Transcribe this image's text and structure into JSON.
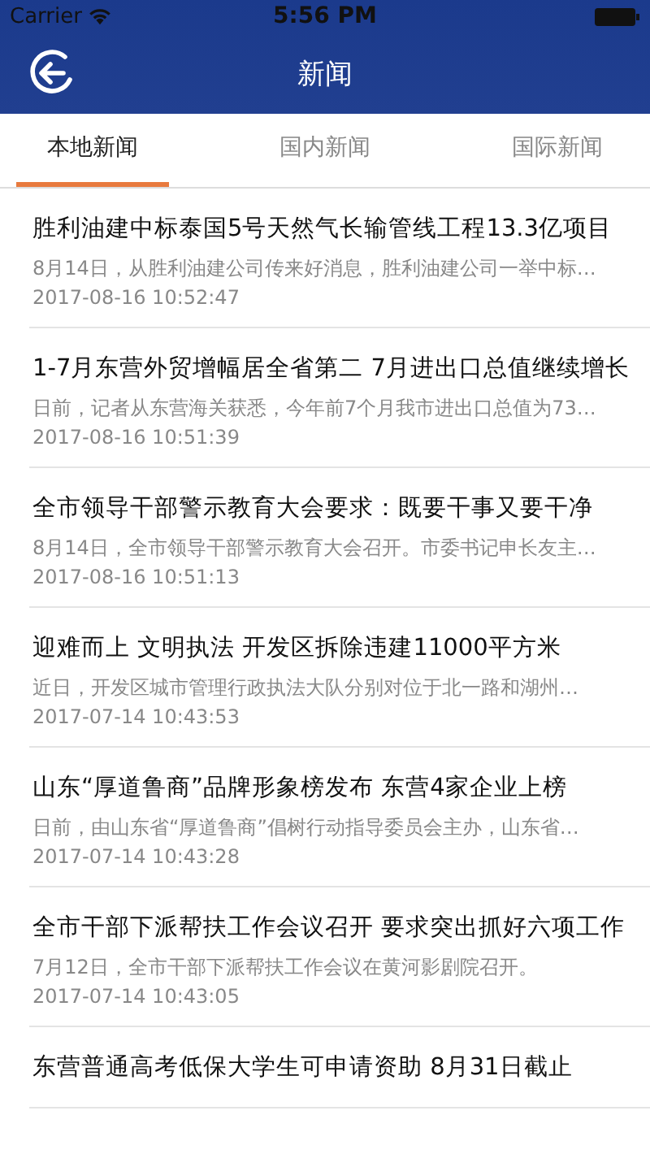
{
  "status_bar": {
    "carrier": "Carrier",
    "time": "5:56 PM"
  },
  "nav": {
    "title": "新闻"
  },
  "tabs": [
    {
      "label": "本地新闻",
      "selected": true
    },
    {
      "label": "国内新闻",
      "selected": false
    },
    {
      "label": "国际新闻",
      "selected": false
    }
  ],
  "news": [
    {
      "title": "胜利油建中标泰国5号天然气长输管线工程13.3亿项目",
      "summary": "8月14日，从胜利油建公司传来好消息，胜利油建公司一举中标…",
      "date": "2017-08-16 10:52:47"
    },
    {
      "title": "1-7月东营外贸增幅居全省第二 7月进出口总值继续增长",
      "summary": "日前，记者从东营海关获悉，今年前7个月我市进出口总值为73…",
      "date": "2017-08-16 10:51:39"
    },
    {
      "title": "全市领导干部警示教育大会要求：既要干事又要干净",
      "summary": "8月14日，全市领导干部警示教育大会召开。市委书记申长友主…",
      "date": "2017-08-16 10:51:13"
    },
    {
      "title": "迎难而上 文明执法 开发区拆除违建11000平方米",
      "summary": "近日，开发区城市管理行政执法大队分别对位于北一路和湖州…",
      "date": "2017-07-14 10:43:53"
    },
    {
      "title": "山东“厚道鲁商”品牌形象榜发布 东营4家企业上榜",
      "summary": "日前，由山东省“厚道鲁商”倡树行动指导委员会主办，山东省…",
      "date": "2017-07-14 10:43:28"
    },
    {
      "title": "全市干部下派帮扶工作会议召开 要求突出抓好六项工作",
      "summary": "7月12日，全市干部下派帮扶工作会议在黄河影剧院召开。",
      "date": "2017-07-14 10:43:05"
    },
    {
      "title": "东营普通高考低保大学生可申请资助 8月31日截止"
    }
  ]
}
